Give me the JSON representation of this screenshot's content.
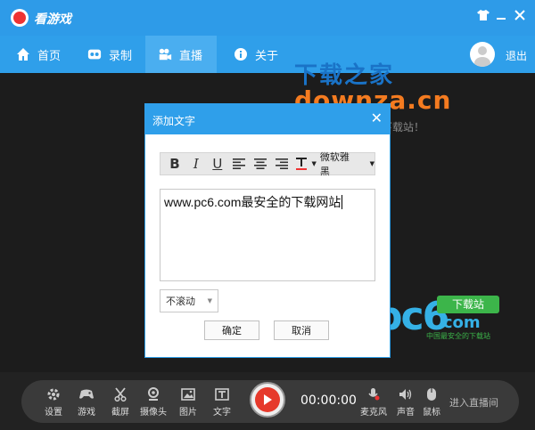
{
  "app": {
    "title": "看游戏",
    "accent": "#2e9be8"
  },
  "nav": {
    "items": [
      {
        "label": "首页",
        "icon": "home-icon"
      },
      {
        "label": "录制",
        "icon": "record-tape-icon"
      },
      {
        "label": "直播",
        "icon": "camera-icon"
      },
      {
        "label": "关于",
        "icon": "info-icon"
      }
    ],
    "active": "直播",
    "logout": "退出"
  },
  "watermark": {
    "line1": "下载之家",
    "line2": "downza.cn",
    "line3": "国内最专业的资源下载站！"
  },
  "pc6": {
    "brand": "pc6",
    "badge": "下载站",
    "com": ".com",
    "sub": "中国最安全的下载站"
  },
  "dialog": {
    "title": "添加文字",
    "toolbar": {
      "bold": "B",
      "italic": "I",
      "underline": "U",
      "font": "微软雅黑"
    },
    "text": "www.pc6.com最安全的下载网站",
    "scroll_option": "不滚动",
    "ok": "确定",
    "cancel": "取消"
  },
  "bottom": {
    "tools": [
      {
        "label": "设置",
        "icon": "gear-icon"
      },
      {
        "label": "游戏",
        "icon": "gamepad-icon"
      },
      {
        "label": "截屏",
        "icon": "scissors-icon"
      },
      {
        "label": "摄像头",
        "icon": "webcam-icon"
      },
      {
        "label": "图片",
        "icon": "image-icon"
      },
      {
        "label": "文字",
        "icon": "text-icon"
      }
    ],
    "timer": "00:00:00",
    "audio": [
      {
        "label": "麦克风",
        "icon": "microphone-muted-icon"
      },
      {
        "label": "声音",
        "icon": "speaker-icon"
      },
      {
        "label": "鼠标",
        "icon": "mouse-icon"
      }
    ],
    "live": "进入直播间"
  }
}
